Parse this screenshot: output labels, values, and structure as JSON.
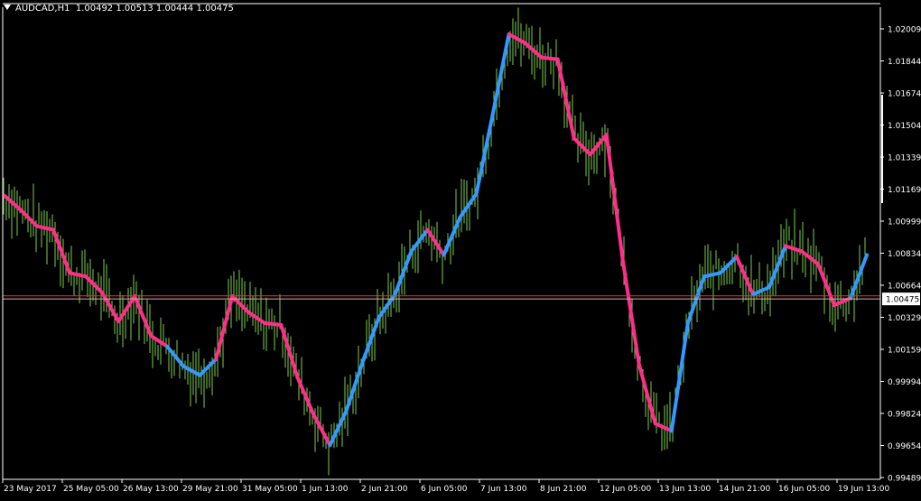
{
  "header": {
    "symbol": "AUDCAD,H1",
    "open": "1.00492",
    "high": "1.00513",
    "low": "1.00444",
    "close": "1.00475"
  },
  "colors": {
    "background": "#000000",
    "bars": "#7CCB4E",
    "ma_up": "#3399FF",
    "ma_down": "#FF2E8A",
    "bid_line": "#FF2A2A",
    "price_line": "#BBBBBB",
    "axis": "#FFFFFF"
  },
  "chart_data": {
    "type": "line",
    "title": "AUDCAD,H1",
    "xlabel": "",
    "ylabel": "",
    "ylim": [
      0.9947,
      1.021
    ],
    "grid": false,
    "y_ticks": [
      "1.02009",
      "1.01844",
      "1.01674",
      "1.01504",
      "1.01339",
      "1.01169",
      "1.00999",
      "1.00834",
      "1.00664",
      "1.00329",
      "1.00159",
      "0.99994",
      "0.99824",
      "0.99654",
      "0.99489"
    ],
    "x_ticks": [
      "23 May 2017",
      "25 May 05:00",
      "26 May 13:00",
      "29 May 21:00",
      "31 May 05:00",
      "1 Jun 13:00",
      "2 Jun 21:00",
      "6 Jun 05:00",
      "7 Jun 13:00",
      "8 Jun 21:00",
      "12 Jun 05:00",
      "13 Jun 13:00",
      "14 Jun 21:00",
      "16 Jun 05:00",
      "19 Jun 13:00"
    ],
    "current_price_label": "1.00475",
    "current_price": 1.00475,
    "bid_price": 1.00492,
    "series": [
      {
        "kind": "moving-average",
        "values": [
          1.0105,
          1.0097,
          1.0088,
          1.0086,
          1.0062,
          1.006,
          1.0051,
          1.0035,
          1.0049,
          1.0027,
          1.0021,
          1.001,
          1.0005,
          1.0014,
          1.0049,
          1.004,
          1.0034,
          1.0033,
          1.0004,
          0.9983,
          0.9966,
          0.9985,
          1.0012,
          1.0037,
          1.005,
          1.0074,
          1.0086,
          1.0072,
          1.0093,
          1.0106,
          1.015,
          1.0195,
          1.019,
          1.0182,
          1.0181,
          1.0137,
          1.0128,
          1.0139,
          1.0069,
          1.0011,
          0.9978,
          0.9974,
          1.0034,
          1.006,
          1.0062,
          1.0071,
          1.005,
          1.0054,
          1.0077,
          1.0074,
          1.0067,
          1.0044,
          1.0048,
          1.0072
        ],
        "segments": [
          "down",
          "down",
          "down",
          "down",
          "down",
          "down",
          "down",
          "down",
          "down",
          "down",
          "up",
          "up",
          "up",
          "down",
          "down",
          "down",
          "down",
          "down",
          "down",
          "down",
          "up",
          "up",
          "up",
          "up",
          "up",
          "up",
          "down",
          "up",
          "up",
          "up",
          "up",
          "down",
          "down",
          "down",
          "down",
          "down",
          "down",
          "down",
          "down",
          "down",
          "down",
          "up",
          "up",
          "up",
          "up",
          "down",
          "up",
          "up",
          "down",
          "down",
          "down",
          "down",
          "up"
        ]
      }
    ]
  }
}
